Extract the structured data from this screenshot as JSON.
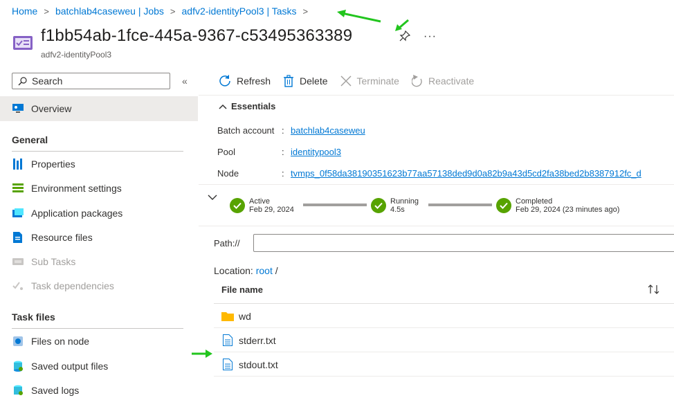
{
  "breadcrumb": [
    {
      "label": "Home"
    },
    {
      "label": "batchlab4caseweu | Jobs"
    },
    {
      "label": "adfv2-identityPool3 | Tasks"
    }
  ],
  "header": {
    "title": "f1bb54ab-1fce-445a-9367-c53495363389",
    "subtitle": "adfv2-identityPool3",
    "more": "···"
  },
  "sidebar": {
    "search_placeholder": "Search",
    "collapse": "«",
    "overview": "Overview",
    "sections": [
      {
        "title": "General",
        "items": [
          {
            "label": "Properties",
            "icon": "properties-icon",
            "disabled": false
          },
          {
            "label": "Environment settings",
            "icon": "environment-settings-icon",
            "disabled": false
          },
          {
            "label": "Application packages",
            "icon": "application-packages-icon",
            "disabled": false
          },
          {
            "label": "Resource files",
            "icon": "resource-files-icon",
            "disabled": false
          },
          {
            "label": "Sub Tasks",
            "icon": "sub-tasks-icon",
            "disabled": true
          },
          {
            "label": "Task dependencies",
            "icon": "task-dependencies-icon",
            "disabled": true
          }
        ]
      },
      {
        "title": "Task files",
        "items": [
          {
            "label": "Files on node",
            "icon": "files-on-node-icon",
            "disabled": false
          },
          {
            "label": "Saved output files",
            "icon": "saved-output-files-icon",
            "disabled": false
          },
          {
            "label": "Saved logs",
            "icon": "saved-logs-icon",
            "disabled": false
          }
        ]
      }
    ]
  },
  "toolbar": {
    "refresh": "Refresh",
    "delete": "Delete",
    "terminate": "Terminate",
    "reactivate": "Reactivate"
  },
  "essentials": {
    "title": "Essentials",
    "rows": [
      {
        "label": "Batch account",
        "value": "batchlab4caseweu"
      },
      {
        "label": "Pool",
        "value": "identitypool3"
      },
      {
        "label": "Node",
        "value": "tvmps_0f58da38190351623b77aa57138ded9d0a82b9a43d5cd2fa38bed2b8387912fc_d"
      }
    ]
  },
  "timeline": [
    {
      "state": "Active",
      "detail": "Feb 29, 2024"
    },
    {
      "state": "Running",
      "detail": "4.5s"
    },
    {
      "state": "Completed",
      "detail": "Feb 29, 2024 (23 minutes ago)"
    }
  ],
  "files": {
    "path_label": "Path://",
    "path_value": "",
    "location_label": "Location:",
    "location_root": "root",
    "location_sep": "/",
    "column_header": "File name",
    "rows": [
      {
        "name": "wd",
        "type": "folder"
      },
      {
        "name": "stderr.txt",
        "type": "file"
      },
      {
        "name": "stdout.txt",
        "type": "file"
      }
    ]
  },
  "colors": {
    "accent": "#0078d4",
    "success": "#57a300",
    "annotation": "#22c51e",
    "folder": "#ffb900"
  }
}
